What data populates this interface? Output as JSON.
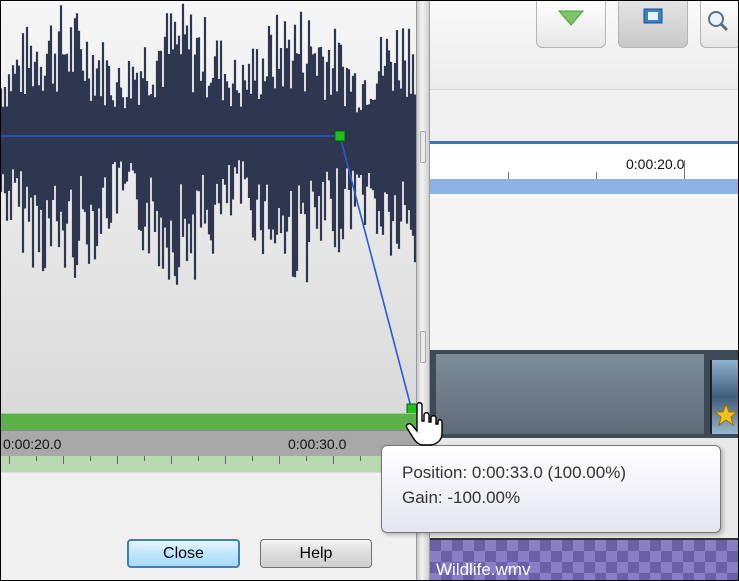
{
  "audio_editor": {
    "ruler": {
      "label_1": "0:00:20.0",
      "label_2": "0:00:30.0"
    },
    "envelope": {
      "start_gain_pct": 0,
      "end_gain_pct": -100
    },
    "buttons": {
      "close_label": "Close",
      "help_label": "Help"
    }
  },
  "timeline": {
    "time_label": "0:00:20.0",
    "audio_clip_name": "Wildlife.wmv"
  },
  "tooltip": {
    "position_line": "Position: 0:00:33.0 (100.00%)",
    "gain_line": "Gain: -100.00%"
  },
  "colors": {
    "waveform": "#2e3650",
    "envelope_line": "#2a5bd1",
    "envelope_point": "#1fbf1f",
    "ruler_band": "#5cb14a",
    "timeline_accent": "#3e6fd0"
  }
}
